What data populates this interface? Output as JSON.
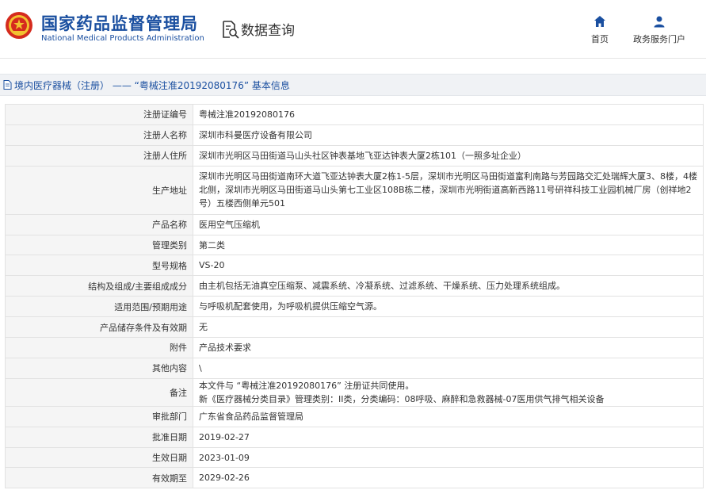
{
  "header": {
    "brand_cn": "国家药品监督管理局",
    "brand_en": "National Medical Products Administration",
    "module": "数据查询",
    "nav": [
      {
        "label": "首页",
        "icon": "home-icon"
      },
      {
        "label": "政务服务门户",
        "icon": "user-icon"
      }
    ]
  },
  "titlebar": {
    "text": "境内医疗器械（注册） —— “粤械注准20192080176” 基本信息"
  },
  "rows": [
    {
      "label": "注册证编号",
      "value": "粤械注准20192080176"
    },
    {
      "label": "注册人名称",
      "value": "深圳市科曼医疗设备有限公司"
    },
    {
      "label": "注册人住所",
      "value": "深圳市光明区马田街道马山头社区钟表基地飞亚达钟表大厦2栋101（一照多址企业）"
    },
    {
      "label": "生产地址",
      "value": "深圳市光明区马田街道南环大道飞亚达钟表大厦2栋1-5层，深圳市光明区马田街道富利南路与芳园路交汇处瑞辉大厦3、8楼，4楼北侧，深圳市光明区马田街道马山头第七工业区108B栋二楼，深圳市光明街道高新西路11号研祥科技工业园机械厂房（创祥地2号）五楼西侧单元501"
    },
    {
      "label": "产品名称",
      "value": "医用空气压缩机"
    },
    {
      "label": "管理类别",
      "value": "第二类"
    },
    {
      "label": "型号规格",
      "value": "VS-20"
    },
    {
      "label": "结构及组成/主要组成成分",
      "value": "由主机包括无油真空压缩泵、减震系统、冷凝系统、过滤系统、干燥系统、压力处理系统组成。"
    },
    {
      "label": "适用范围/预期用途",
      "value": "与呼吸机配套使用，为呼吸机提供压缩空气源。"
    },
    {
      "label": "产品储存条件及有效期",
      "value": "无"
    },
    {
      "label": "附件",
      "value": "产品技术要求"
    },
    {
      "label": "其他内容",
      "value": "\\"
    },
    {
      "label": "备注",
      "value": "本文件与 “粤械注准20192080176” 注册证共同使用。",
      "value2": "新《医疗器械分类目录》管理类别：II类，分类编码：08呼吸、麻醉和急救器械-07医用供气排气相关设备"
    },
    {
      "label": "审批部门",
      "value": "广东省食品药品监督管理局"
    },
    {
      "label": "批准日期",
      "value": "2019-02-27"
    },
    {
      "label": "生效日期",
      "value": "2023-01-09"
    },
    {
      "label": "有效期至",
      "value": "2029-02-26"
    }
  ]
}
